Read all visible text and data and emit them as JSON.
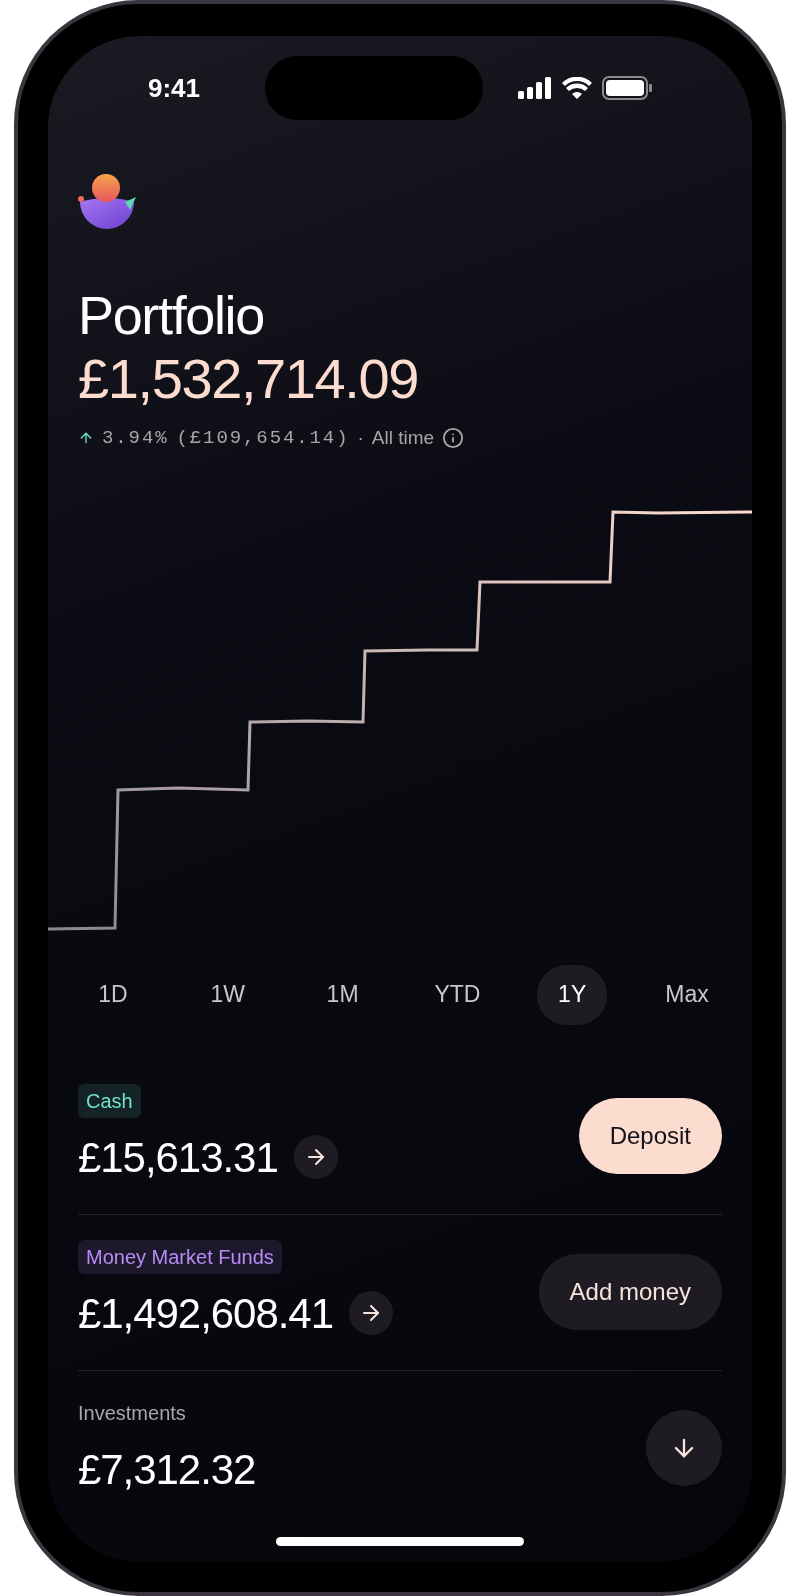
{
  "status_bar": {
    "time": "9:41"
  },
  "header": {
    "title": "Portfolio",
    "value": "£1,532,714.09",
    "change": {
      "percent": "3.94%",
      "amount": "(£109,654.14)",
      "separator": "·",
      "period": "All time"
    }
  },
  "periods": [
    {
      "label": "1D",
      "selected": false
    },
    {
      "label": "1W",
      "selected": false
    },
    {
      "label": "1M",
      "selected": false
    },
    {
      "label": "YTD",
      "selected": false
    },
    {
      "label": "1Y",
      "selected": true
    },
    {
      "label": "Max",
      "selected": false
    }
  ],
  "accounts": [
    {
      "kind": "tag",
      "label": "Cash",
      "color": "#6fe3c4",
      "amount": "£15,613.31",
      "link": true,
      "action": {
        "kind": "primary",
        "label": "Deposit"
      }
    },
    {
      "kind": "tag",
      "label": "Money Market Funds",
      "color": "#b88cf6",
      "amount": "£1,492,608.41",
      "link": true,
      "action": {
        "kind": "secondary",
        "label": "Add money"
      }
    },
    {
      "kind": "plain",
      "label": "Investments",
      "amount": "£7,312.32",
      "link": false,
      "action": {
        "kind": "icon"
      }
    }
  ]
}
